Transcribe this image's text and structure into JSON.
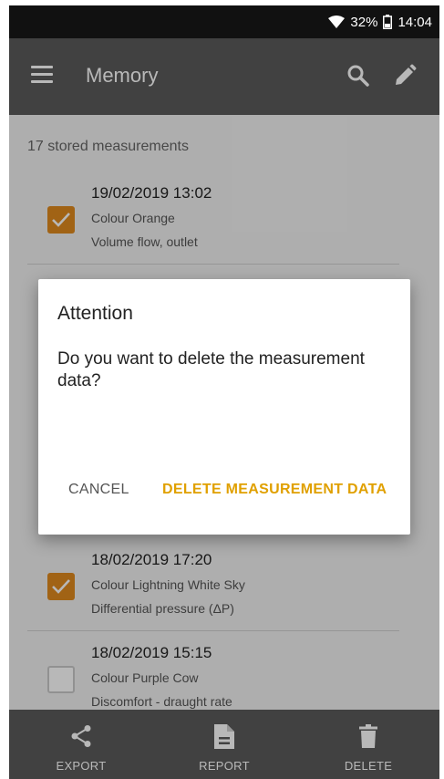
{
  "status": {
    "battery": "32%",
    "time": "14:04"
  },
  "appbar": {
    "title": "Memory"
  },
  "summary": {
    "stored_count": "17 stored measurements"
  },
  "measurements": [
    {
      "date": "19/02/2019 13:02",
      "colour": "Colour Orange",
      "description": "Volume flow, outlet",
      "checked": true
    },
    {
      "date": "18/02/2019 17:20",
      "colour": "Colour Lightning White Sky",
      "description": "Differential pressure (ΔP)",
      "checked": true
    },
    {
      "date": "18/02/2019 15:15",
      "colour": "Colour Purple Cow",
      "description": "Discomfort - draught rate",
      "checked": false
    }
  ],
  "dialog": {
    "title": "Attention",
    "message": "Do you want to delete the measurement data?",
    "cancel_label": "CANCEL",
    "confirm_label": "DELETE MEASUREMENT DATA"
  },
  "bottombar": {
    "export_label": "EXPORT",
    "report_label": "REPORT",
    "delete_label": "DELETE"
  },
  "colors": {
    "accent": "#e08a1e",
    "dialog_action": "#e0a000",
    "bar": "#5b5b5b"
  }
}
